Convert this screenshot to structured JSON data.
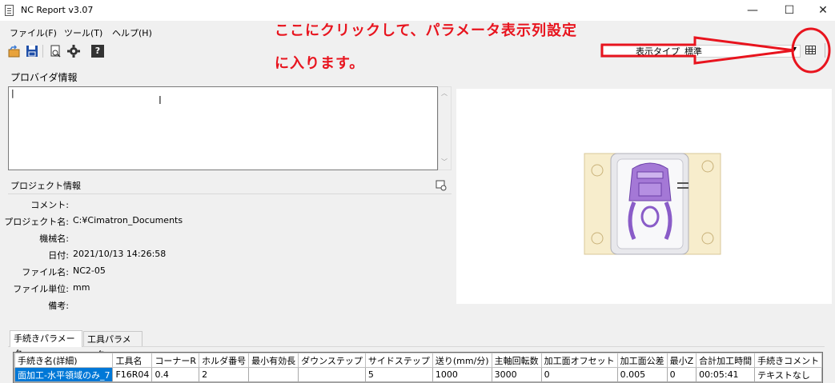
{
  "window": {
    "title": "NC Report v3.07",
    "minimize": "—",
    "maximize": "☐",
    "close": "✕"
  },
  "menu": [
    "ファイル(F)",
    "ツール(T)",
    "ヘルプ(H)"
  ],
  "toolbar": {
    "icons": [
      "open-icon",
      "save-icon",
      "export-icon",
      "gear-icon",
      "help-icon"
    ],
    "help_glyph": "?",
    "display_type_label": "表示タイプ",
    "display_type_value": "標準",
    "dropdown_arrow": "▾",
    "param_column_settings_icon": "grid-icon"
  },
  "annotation": {
    "line1": "ここにクリックして、パラメータ表示列設定",
    "line2": "に入ります。",
    "color": "#e8141e"
  },
  "provider": {
    "label": "プロバイダ情報",
    "text": "|"
  },
  "project": {
    "label": "プロジェクト情報",
    "fields": [
      {
        "label": "コメント:",
        "value": ""
      },
      {
        "label": "プロジェクト名:",
        "value": "C:¥Cimatron_Documents"
      },
      {
        "label": "機械名:",
        "value": ""
      },
      {
        "label": "日付:",
        "value": "2021/10/13 14:26:58"
      },
      {
        "label": "ファイル名:",
        "value": "NC2-05"
      },
      {
        "label": "ファイル単位:",
        "value": "mm"
      },
      {
        "label": "備考:",
        "value": ""
      }
    ]
  },
  "tabs": [
    "手続きパラメータ",
    "工具パラメータ"
  ],
  "grid": {
    "columns": [
      "手続き名(詳細)",
      "工具名",
      "コーナーR",
      "ホルダ番号",
      "最小有効長",
      "ダウンステップ",
      "サイドステップ",
      "送り(mm/分)",
      "主軸回転数",
      "加工面オフセット",
      "加工面公差",
      "最小Z",
      "合計加工時間",
      "手続きコメント"
    ],
    "rows": [
      [
        "面加工-水平領域のみ_7",
        "F16R04",
        "0.4",
        "2",
        "",
        "",
        "5",
        "1000",
        "3000",
        "0",
        "0.005",
        "0",
        "00:05:41",
        "テキストなし"
      ]
    ]
  }
}
